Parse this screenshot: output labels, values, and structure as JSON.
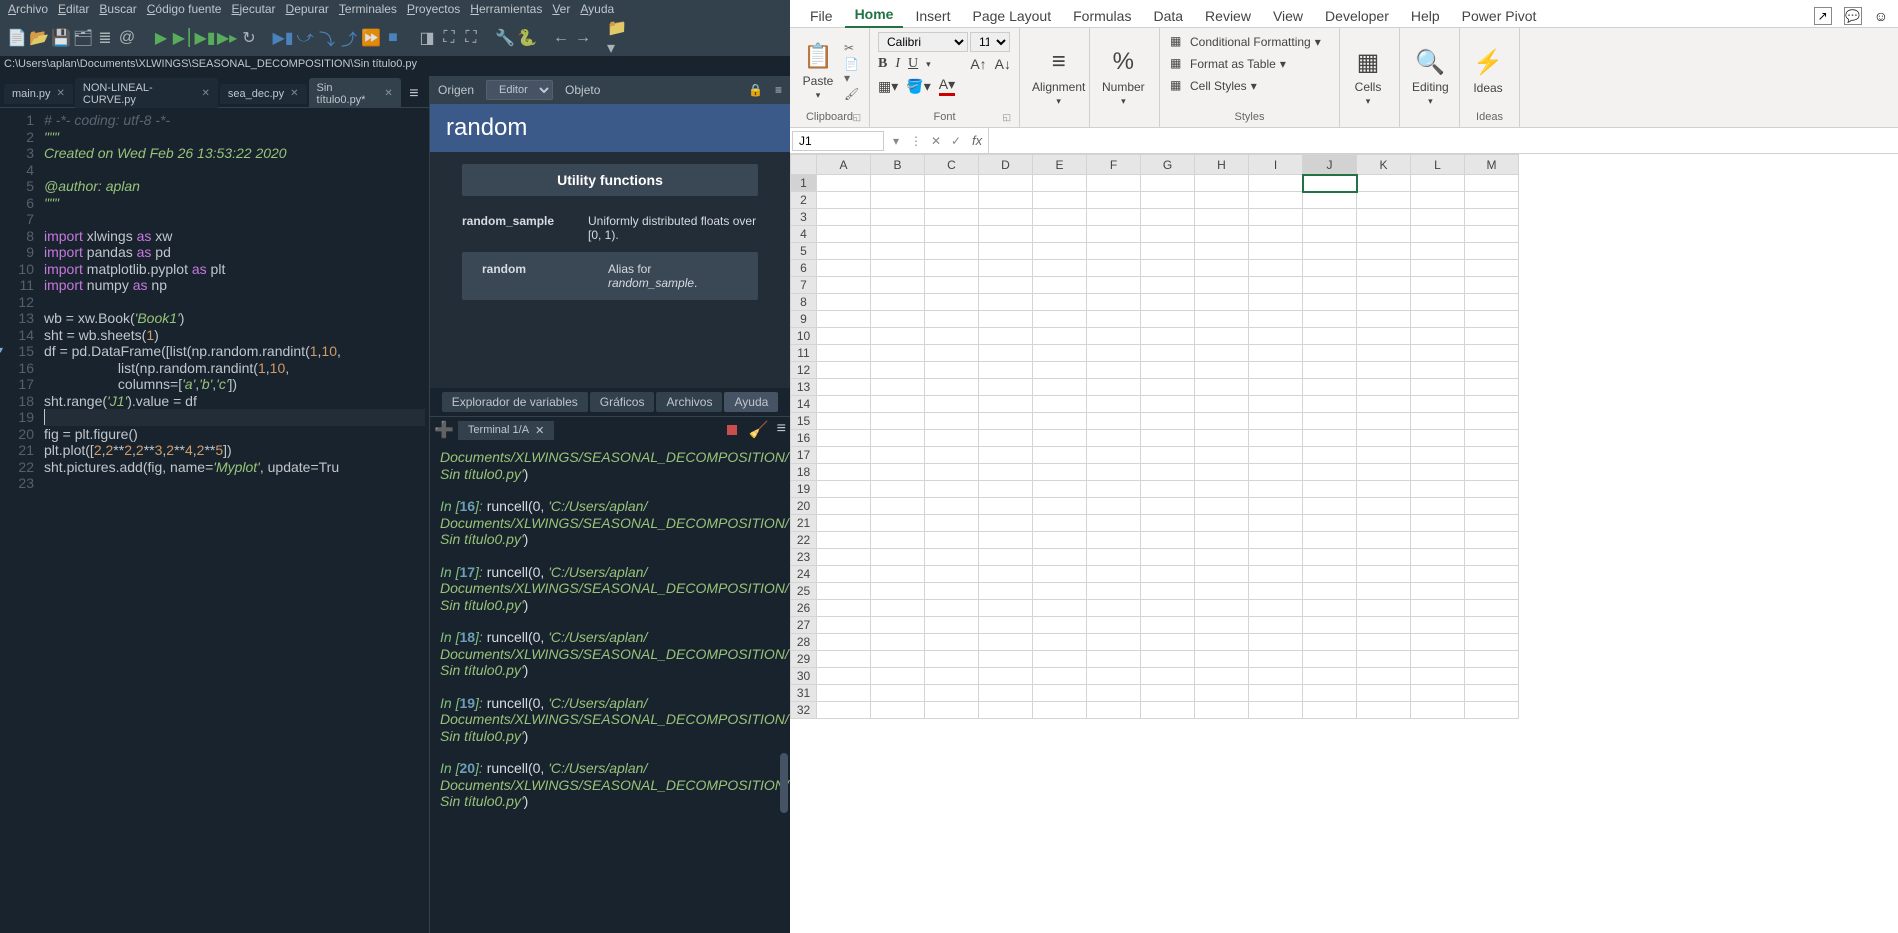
{
  "spyder": {
    "menu": [
      "Archivo",
      "Editar",
      "Buscar",
      "Código fuente",
      "Ejecutar",
      "Depurar",
      "Terminales",
      "Proyectos",
      "Herramientas",
      "Ver",
      "Ayuda"
    ],
    "path": "C:\\Users\\aplan\\Documents\\XLWINGS\\SEASONAL_DECOMPOSITION\\Sin título0.py",
    "tabs": [
      {
        "label": "main.py",
        "active": false
      },
      {
        "label": "NON-LINEAL-CURVE.py",
        "active": false
      },
      {
        "label": "sea_dec.py",
        "active": false
      },
      {
        "label": "Sin título0.py*",
        "active": true
      }
    ],
    "code_lines": [
      "# -*- coding: utf-8 -*-",
      "\"\"\"",
      "Created on Wed Feb 26 13:53:22 2020",
      "",
      "@author: aplan",
      "\"\"\"",
      "",
      "import xlwings as xw",
      "import pandas as pd",
      "import matplotlib.pyplot as plt",
      "import numpy as np",
      "",
      "wb = xw.Book('Book1')",
      "sht = wb.sheets(1)",
      "df = pd.DataFrame([list(np.random.randint(1,10,",
      "                   list(np.random.randint(1,10,",
      "                   columns=['a','b','c'])",
      "sht.range('J1').value = df",
      "",
      "fig = plt.figure()",
      "plt.plot([2,2**2,2**3,2**4,2**5])",
      "sht.pictures.add(fig, name='Myplot', update=Tru",
      ""
    ],
    "help": {
      "origen": "Origen",
      "editor": "Editor",
      "objeto": "Objeto",
      "title": "random",
      "section": "Utility functions",
      "rows": [
        {
          "k": "random_sample",
          "v": "Uniformly distributed floats over [0, 1)."
        },
        {
          "k": "random",
          "v": "Alias for random_sample."
        }
      ],
      "tabs": [
        "Explorador de variables",
        "Gráficos",
        "Archivos",
        "Ayuda"
      ]
    },
    "console": {
      "tab": "Terminal 1/A",
      "entries": [
        {
          "pre": "",
          "path": "Documents/XLWINGS/SEASONAL_DECOMPOSITION/Sin título0.py",
          "suf": "')"
        },
        {
          "n": "16",
          "cmd": "runcell(0, ",
          "path": "'C:/Users/aplan/Documents/XLWINGS/SEASONAL_DECOMPOSITION/Sin título0.py'",
          "suf": ")"
        },
        {
          "n": "17",
          "cmd": "runcell(0, ",
          "path": "'C:/Users/aplan/Documents/XLWINGS/SEASONAL_DECOMPOSITION/Sin título0.py'",
          "suf": ")"
        },
        {
          "n": "18",
          "cmd": "runcell(0, ",
          "path": "'C:/Users/aplan/Documents/XLWINGS/SEASONAL_DECOMPOSITION/Sin título0.py'",
          "suf": ")"
        },
        {
          "n": "19",
          "cmd": "runcell(0, ",
          "path": "'C:/Users/aplan/Documents/XLWINGS/SEASONAL_DECOMPOSITION/Sin título0.py'",
          "suf": ")"
        },
        {
          "n": "20",
          "cmd": "runcell(0, ",
          "path": "'C:/Users/aplan/Documents/XLWINGS/SEASONAL_DECOMPOSITION/Sin título0.py'",
          "suf": ")"
        }
      ]
    }
  },
  "excel": {
    "tabs": [
      "File",
      "Home",
      "Insert",
      "Page Layout",
      "Formulas",
      "Data",
      "Review",
      "View",
      "Developer",
      "Help",
      "Power Pivot"
    ],
    "active_tab": "Home",
    "ribbon": {
      "clipboard": "Clipboard",
      "paste": "Paste",
      "font": "Font",
      "font_name": "Calibri",
      "font_size": "11",
      "alignment": "Alignment",
      "number": "Number",
      "styles": "Styles",
      "cond": "Conditional Formatting",
      "table": "Format as Table",
      "cellstyles": "Cell Styles",
      "cells": "Cells",
      "editing": "Editing",
      "ideas": "Ideas"
    },
    "namebox": "J1",
    "columns": [
      "A",
      "B",
      "C",
      "D",
      "E",
      "F",
      "G",
      "H",
      "I",
      "J",
      "K",
      "L",
      "M"
    ],
    "rows": 32
  }
}
